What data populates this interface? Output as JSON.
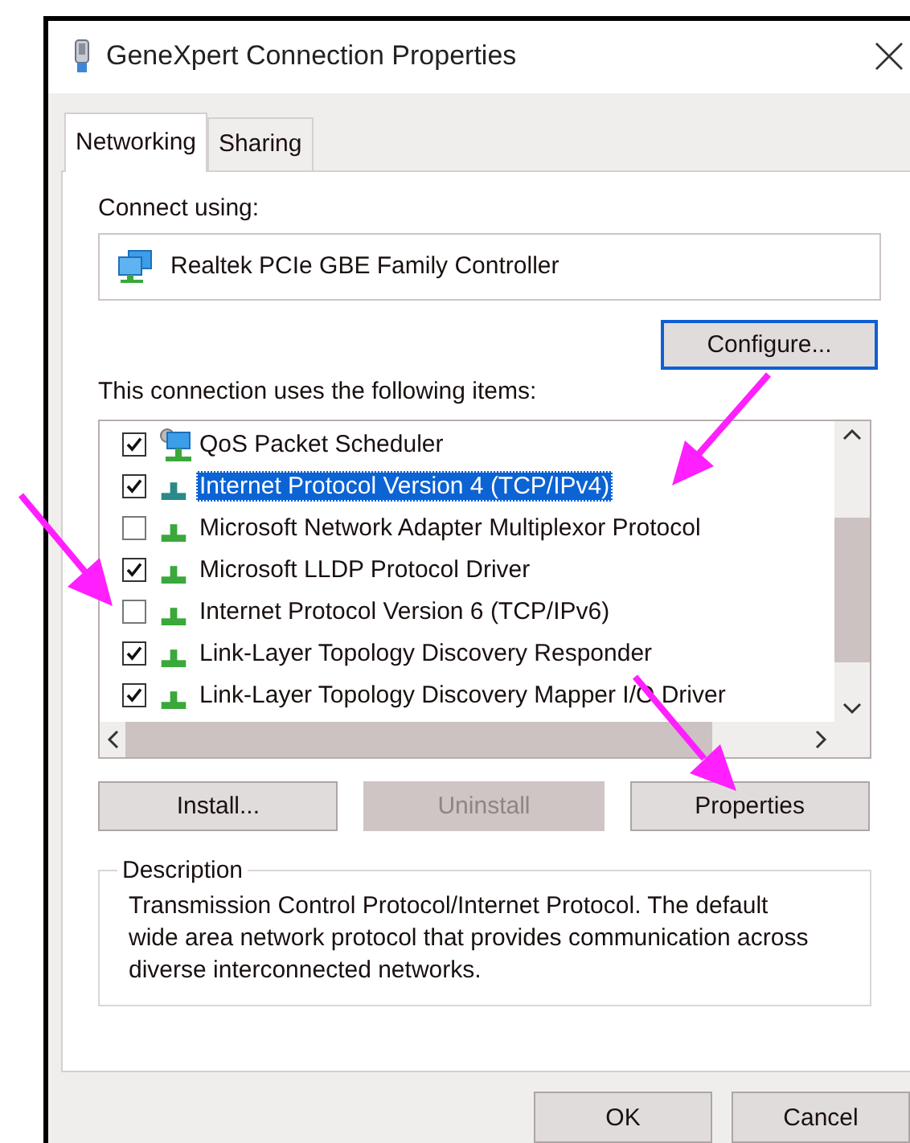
{
  "window": {
    "title": "GeneXpert Connection Properties"
  },
  "tabs": [
    {
      "label": "Networking",
      "selected": true
    },
    {
      "label": "Sharing",
      "selected": false
    }
  ],
  "connect_using": {
    "label": "Connect using:",
    "adapter": "Realtek PCIe GBE Family Controller"
  },
  "configure_button": {
    "label": "Configure...",
    "focused": true
  },
  "items_label": "This connection uses the following items:",
  "items": [
    {
      "name": "QoS Packet Scheduler",
      "checked": true,
      "selected": false,
      "kind": "service"
    },
    {
      "name": "Internet Protocol Version 4 (TCP/IPv4)",
      "checked": true,
      "selected": true,
      "kind": "protocol"
    },
    {
      "name": "Microsoft Network Adapter Multiplexor Protocol",
      "checked": false,
      "selected": false,
      "kind": "protocol"
    },
    {
      "name": "Microsoft LLDP Protocol Driver",
      "checked": true,
      "selected": false,
      "kind": "protocol"
    },
    {
      "name": "Internet Protocol Version 6 (TCP/IPv6)",
      "checked": false,
      "selected": false,
      "kind": "protocol"
    },
    {
      "name": "Link-Layer Topology Discovery Responder",
      "checked": true,
      "selected": false,
      "kind": "protocol"
    },
    {
      "name": "Link-Layer Topology Discovery Mapper I/O Driver",
      "checked": true,
      "selected": false,
      "kind": "protocol"
    }
  ],
  "item_buttons": [
    {
      "label": "Install...",
      "disabled": false
    },
    {
      "label": "Uninstall",
      "disabled": true
    },
    {
      "label": "Properties",
      "disabled": false
    }
  ],
  "description": {
    "title": "Description",
    "text": "Transmission Control Protocol/Internet Protocol. The default wide area network protocol that provides communication across diverse interconnected networks."
  },
  "dialog_buttons": [
    {
      "label": "OK"
    },
    {
      "label": "Cancel"
    }
  ]
}
